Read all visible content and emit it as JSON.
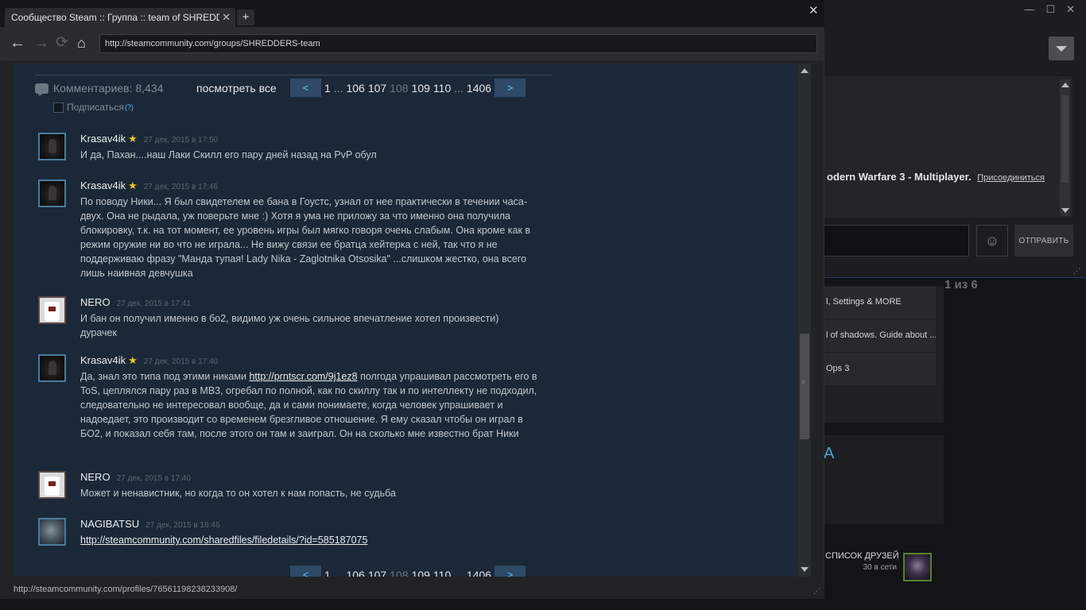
{
  "browser": {
    "tab_title": "Сообщество Steam :: Группа :: team of SHREDDE...",
    "tab_close": "✕",
    "new_tab": "+",
    "window_close": "✕",
    "url": "http://steamcommunity.com/groups/SHREDDERS-team",
    "status_url": "http://steamcommunity.com/profiles/76561198238233908/"
  },
  "comments_header": {
    "count_label": "Комментариев: 8,434",
    "view_all": "посмотреть все",
    "subscribe_label": "Подписаться",
    "help_mark": "(?)"
  },
  "pager": {
    "prev": "<",
    "next": ">",
    "first": "1",
    "dots": "...",
    "pages": [
      "106",
      "107",
      "108",
      "109",
      "110"
    ],
    "current": "108",
    "last": "1406"
  },
  "comments": [
    {
      "author": "Krasav4ik",
      "star": "★",
      "date": "27 дек, 2015 в 17:50",
      "text": "И да, Пахан....наш Лаки Скилл его пару дней назад на PvP обул",
      "avatar": "dark-figure"
    },
    {
      "author": "Krasav4ik",
      "star": "★",
      "date": "27 дек, 2015 в 17:46",
      "text": "По поводу Ники... Я был свидетелем ее бана в Гоустс, узнал от нее практически в течении часа-двух. Она не рыдала, уж поверьте мне :) Хотя я ума не приложу за что именно она получила блокировку, т.к. на тот момент, ее уровень игры был мягко говоря очень слабым. Она кроме как в режим оружие ни во что не играла... Не вижу связи ее братца хейтерка с ней, так что я не поддерживаю фразу \"Манда тупая! Lady Nika - Zaglotnika Otsosika\" ...слишком жестко, она всего лишь наивная девчушка",
      "avatar": "dark-figure"
    },
    {
      "author": "NERO",
      "star": "",
      "date": "27 дек, 2015 в 17:41",
      "text": "И бан он получил именно в бо2, видимо уж очень сильное впечатление хотел произвести) дурачек",
      "avatar": "t-shirt"
    },
    {
      "author": "Krasav4ik",
      "star": "★",
      "date": "27 дек, 2015 в 17:40",
      "text_before": "Да, знал это типа под этими никами ",
      "link": "http://prntscr.com/9j1ez8",
      "text_after": " полгода упрашивал рассмотреть его в ToS, цеплялся пару раз в MB3, огребал по полной, как по скиллу так и по интеллекту не подходил, следовательно не интересовал вообще, да и сами понимаете, когда человек упрашивает и надоедает, это производит со временем брезгливое отношение. Я ему сказал чтобы он играл в БО2, и показал себя там, после этого он там и заиграл. Он на сколько мне известно брат Ники",
      "avatar": "dark-figure"
    },
    {
      "author": "NERO",
      "star": "",
      "date": "27 дек, 2015 в 17:40",
      "text": "Может и ненавистник, но когда то он хотел к нам попасть, не судьба",
      "avatar": "t-shirt"
    },
    {
      "author": "NAGIBATSU",
      "star": "",
      "date": "27 дек, 2015 в 16:46",
      "link": "http://steamcommunity.com/sharedfiles/filedetails/?id=585187075",
      "avatar": "soldier"
    }
  ],
  "background_app": {
    "chat_game": "odern Warfare 3 - Multiplayer.",
    "chat_join": "Присоединиться",
    "send_button": "ОТПРАВИТЬ",
    "page_indicator": "1 из 6",
    "list_items": [
      "l, Settings & MORE",
      "l of shadows. Guide about ...",
      "Ops 3"
    ],
    "partial_letter": "A",
    "friends_label": "СПИСОК ДРУЗЕЙ",
    "friends_online": "30 в сети",
    "emoji_icon": "☺"
  },
  "colors": {
    "page_bg": "#1b2838",
    "link_blue": "#66c0f4",
    "star": "#f4c518",
    "avatar_border": "#4a7c9d"
  }
}
